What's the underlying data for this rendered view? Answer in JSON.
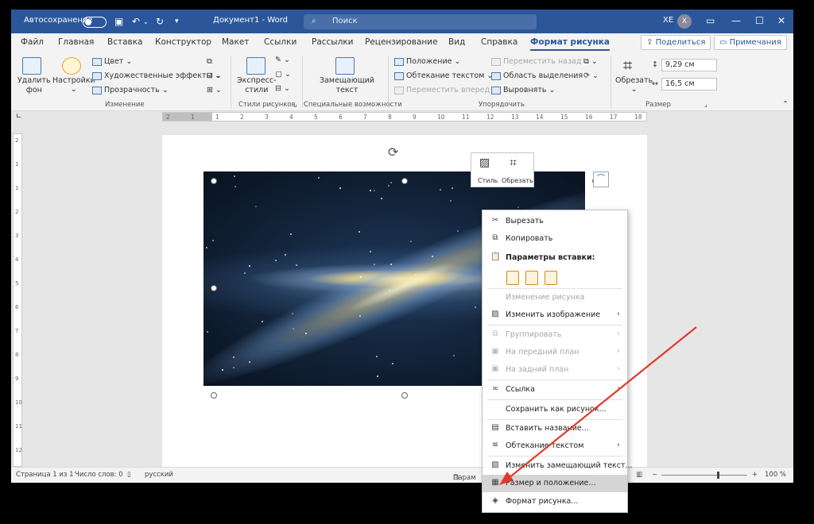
{
  "titlebar": {
    "autosave_label": "Автосохранение",
    "doc_title": "Документ1 - Word",
    "search_placeholder": "Поиск",
    "user_initials": "XE",
    "avatar_initial": "X"
  },
  "tabs": [
    "Файл",
    "Главная",
    "Вставка",
    "Конструктор",
    "Макет",
    "Ссылки",
    "Рассылки",
    "Рецензирование",
    "Вид",
    "Справка",
    "Формат рисунка"
  ],
  "share_label": "Поделиться",
  "comments_label": "Примечания",
  "ribbon": {
    "remove_bg": "Удалить фон",
    "remove_bg_l1": "Удалить",
    "remove_bg_l2": "фон",
    "corrections": "Настройки",
    "color": "Цвет",
    "artistic": "Художественные эффекты",
    "transparency": "Прозрачность",
    "group_adjust": "Изменение",
    "quick_styles_l1": "Экспресс-",
    "quick_styles_l2": "стили",
    "group_styles": "Стили рисунков",
    "alt_text_l1": "Замещающий",
    "alt_text_l2": "текст",
    "group_access": "Специальные возможности",
    "position": "Положение",
    "wrap_text": "Обтекание текстом",
    "bring_forward": "Переместить вперед",
    "send_backward": "Переместить назад",
    "selection_pane": "Область выделения",
    "align": "Выровнять",
    "group_arrange": "Упорядочить",
    "crop": "Обрезать",
    "height": "9,29 см",
    "width": "16,5 см",
    "group_size": "Размер"
  },
  "ruler": {
    "marks": [
      "2",
      "1",
      "1",
      "2",
      "3",
      "4",
      "5",
      "6",
      "7",
      "8",
      "9",
      "10",
      "11",
      "12",
      "13",
      "14",
      "15",
      "16",
      "17",
      "18"
    ],
    "vmarks": [
      "2",
      "1",
      "1",
      "2",
      "3",
      "4",
      "5",
      "6",
      "7",
      "8",
      "9",
      "10",
      "11",
      "12"
    ]
  },
  "minitoolbar": {
    "style": "Стиль",
    "crop": "Обрезать"
  },
  "context_menu": [
    {
      "label": "Вырезать",
      "icon": "scissors-icon"
    },
    {
      "label": "Копировать",
      "icon": "copy-icon"
    },
    {
      "label": "Параметры вставки:",
      "icon": "paste-icon"
    },
    {
      "label": "Изменение рисунка",
      "disabled": true
    },
    {
      "label": "Изменить изображение",
      "icon": "change-picture-icon",
      "submenu": true
    },
    {
      "label": "Группировать",
      "icon": "group-icon",
      "disabled": true,
      "submenu": true
    },
    {
      "label": "На передний план",
      "icon": "bring-front-icon",
      "disabled": true,
      "submenu": true
    },
    {
      "label": "На задний план",
      "icon": "send-back-icon",
      "disabled": true,
      "submenu": true
    },
    {
      "label": "Ссылка",
      "icon": "link-icon",
      "submenu": true
    },
    {
      "label": "Сохранить как рисунок..."
    },
    {
      "label": "Вставить название...",
      "icon": "caption-icon"
    },
    {
      "label": "Обтекание текстом",
      "icon": "wrap-icon",
      "submenu": true
    },
    {
      "label": "Изменить замещающий текст...",
      "icon": "alt-text-icon"
    },
    {
      "label": "Размер и положение...",
      "icon": "size-position-icon",
      "highlighted": true
    },
    {
      "label": "Формат рисунка...",
      "icon": "format-picture-icon"
    }
  ],
  "statusbar": {
    "page": "Страница 1 из 1",
    "words": "Число слов: 0",
    "language": "русский",
    "partial": "Парам",
    "zoom": "100 %"
  },
  "colors": {
    "accent": "#2b579a",
    "arrow": "#e03a2e"
  }
}
